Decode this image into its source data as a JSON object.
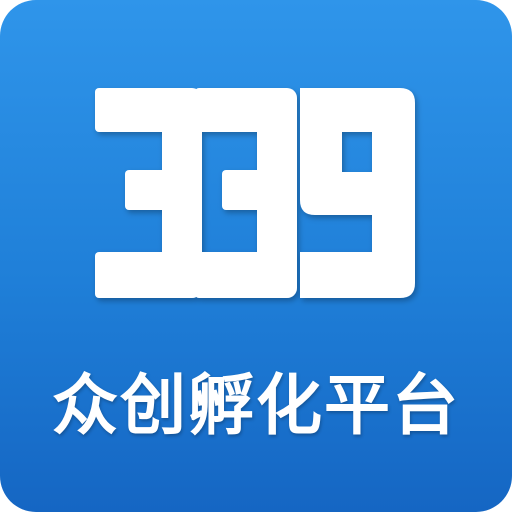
{
  "logo": {
    "text": "339",
    "color": "#ffffff"
  },
  "tagline": "众创孵化平台",
  "colors": {
    "background_top": "#2f95ea",
    "background_bottom": "#1566c3",
    "foreground": "#ffffff"
  }
}
